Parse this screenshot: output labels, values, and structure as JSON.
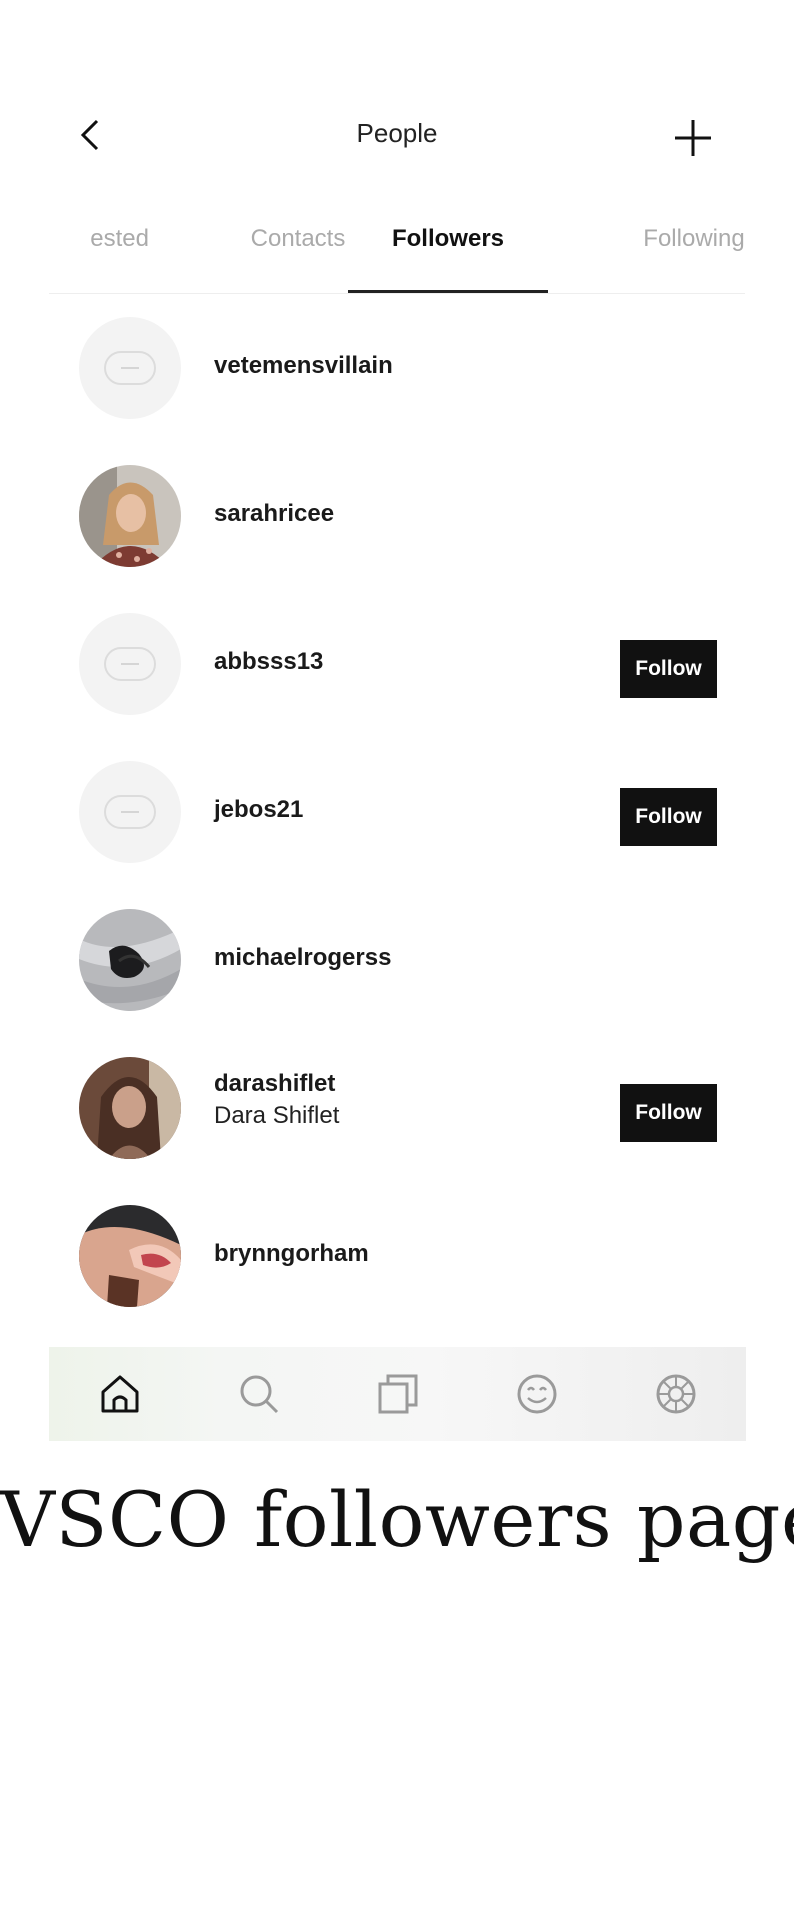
{
  "header": {
    "title": "People"
  },
  "tabs": [
    {
      "label": "ested"
    },
    {
      "label": "Contacts"
    },
    {
      "label": "Followers",
      "active": true
    },
    {
      "label": "Following"
    }
  ],
  "followers": [
    {
      "username": "vetemensvillain",
      "fullname": "",
      "avatar": "placeholder",
      "follow_label": ""
    },
    {
      "username": "sarahricee",
      "fullname": "",
      "avatar": "photo",
      "follow_label": ""
    },
    {
      "username": "abbsss13",
      "fullname": "",
      "avatar": "placeholder",
      "follow_label": "Follow"
    },
    {
      "username": "jebos21",
      "fullname": "",
      "avatar": "placeholder",
      "follow_label": "Follow"
    },
    {
      "username": "michaelrogerss",
      "fullname": "",
      "avatar": "photo",
      "follow_label": ""
    },
    {
      "username": "darashiflet",
      "fullname": "Dara Shiflet",
      "avatar": "photo",
      "follow_label": "Follow"
    },
    {
      "username": "brynngorham",
      "fullname": "",
      "avatar": "photo",
      "follow_label": ""
    }
  ],
  "bottom_nav": {
    "items": [
      {
        "icon": "home-icon",
        "active": true
      },
      {
        "icon": "search-icon"
      },
      {
        "icon": "studio-icon"
      },
      {
        "icon": "smiley-icon"
      },
      {
        "icon": "profile-wheel-icon"
      }
    ]
  },
  "caption": "VSCO followers page",
  "colors": {
    "follow_button_bg": "#111111",
    "inactive_tab": "#aaaaaa",
    "placeholder_avatar": "#f3f3f3"
  }
}
